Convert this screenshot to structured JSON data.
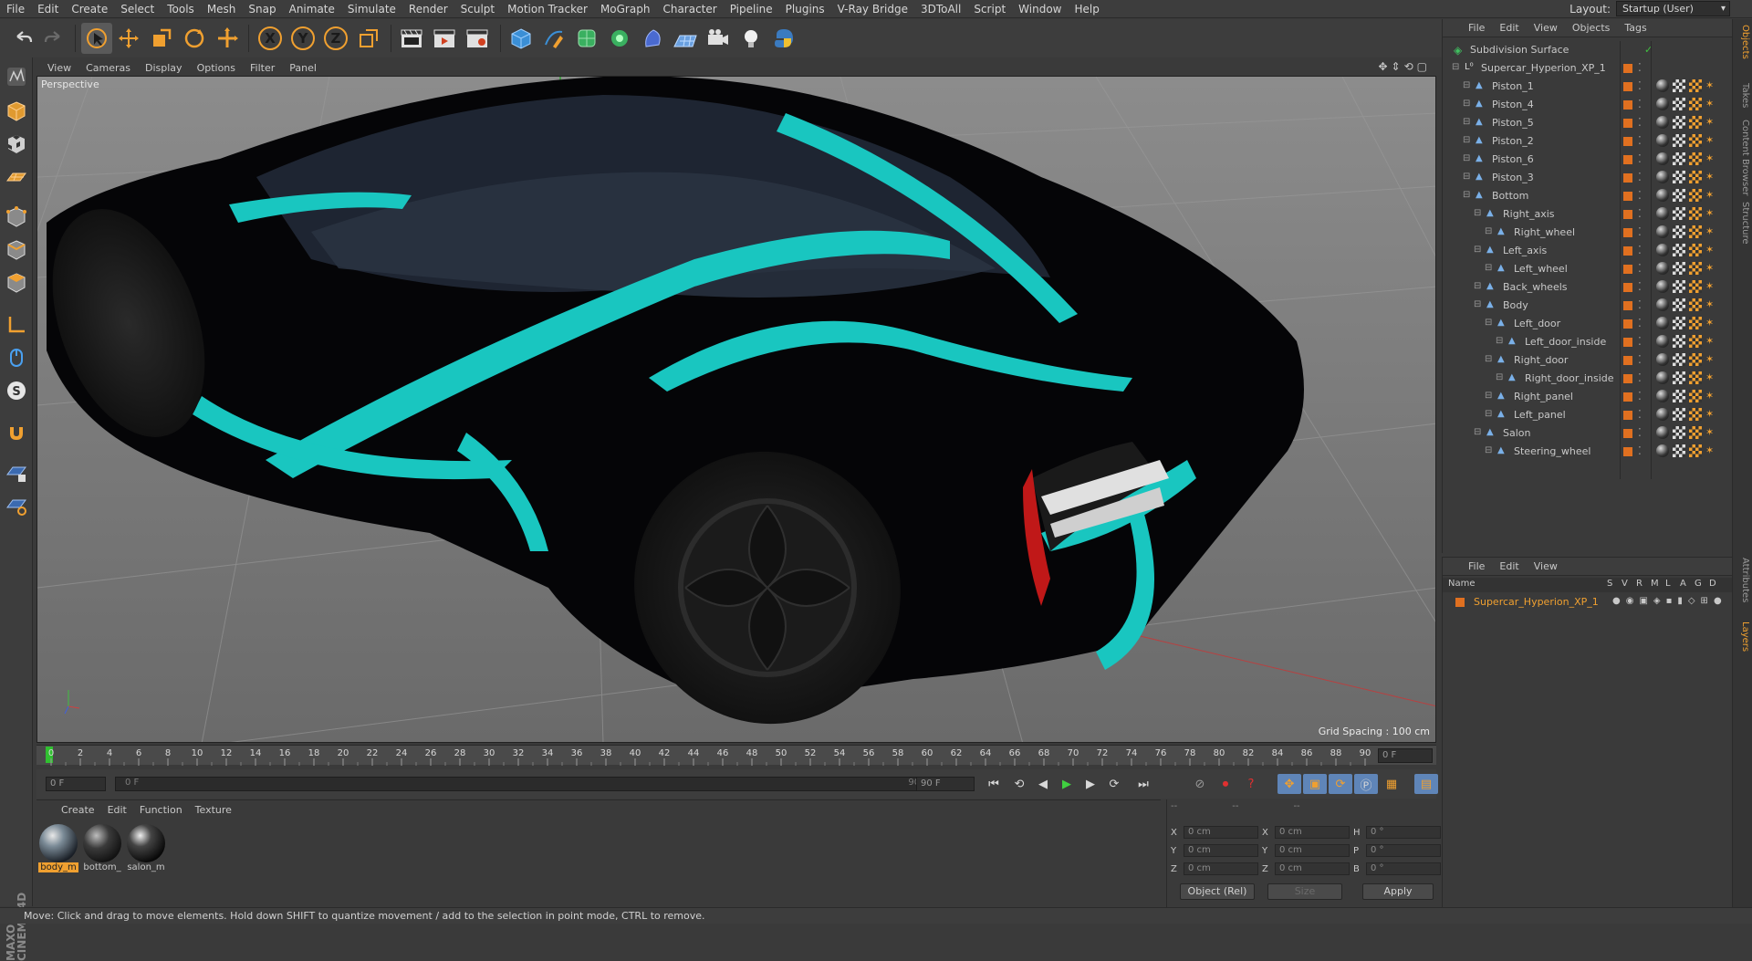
{
  "menubar": {
    "items": [
      "File",
      "Edit",
      "Create",
      "Select",
      "Tools",
      "Mesh",
      "Snap",
      "Animate",
      "Simulate",
      "Render",
      "Sculpt",
      "Motion Tracker",
      "MoGraph",
      "Character",
      "Pipeline",
      "Plugins",
      "V-Ray Bridge",
      "3DToAll",
      "Script",
      "Window",
      "Help"
    ],
    "layout_label": "Layout:",
    "layout_value": "Startup (User)"
  },
  "toolbar": {
    "axis_x": "X",
    "axis_y": "Y",
    "axis_z": "Z"
  },
  "viewport": {
    "menu": [
      "View",
      "Cameras",
      "Display",
      "Options",
      "Filter",
      "Panel"
    ],
    "label": "Perspective",
    "grid_spacing": "Grid Spacing : 100 cm"
  },
  "timeline": {
    "ticks": [
      "0",
      "2",
      "4",
      "6",
      "8",
      "10",
      "12",
      "14",
      "16",
      "18",
      "20",
      "22",
      "24",
      "26",
      "28",
      "30",
      "32",
      "34",
      "36",
      "38",
      "40",
      "42",
      "44",
      "46",
      "48",
      "50",
      "52",
      "54",
      "56",
      "58",
      "60",
      "62",
      "64",
      "66",
      "68",
      "70",
      "72",
      "74",
      "76",
      "78",
      "80",
      "82",
      "84",
      "86",
      "88",
      "90"
    ],
    "current_frame": "0 F",
    "start_field": "0 F",
    "range_start": "0 F",
    "range_end": "90 F",
    "end_field": "90 F"
  },
  "materials": {
    "menu": [
      "Create",
      "Edit",
      "Function",
      "Texture"
    ],
    "items": [
      {
        "name": "body_m",
        "selected": true
      },
      {
        "name": "bottom_",
        "selected": false
      },
      {
        "name": "salon_m",
        "selected": false
      }
    ]
  },
  "coords": {
    "header_left": "--",
    "header_mid": "--",
    "header_right": "--",
    "rows": [
      {
        "a": "X",
        "av": "0 cm",
        "b": "X",
        "bv": "0 cm",
        "c": "H",
        "cv": "0 °"
      },
      {
        "a": "Y",
        "av": "0 cm",
        "b": "Y",
        "bv": "0 cm",
        "c": "P",
        "cv": "0 °"
      },
      {
        "a": "Z",
        "av": "0 cm",
        "b": "Z",
        "bv": "0 cm",
        "c": "B",
        "cv": "0 °"
      }
    ],
    "mode_select": "Object (Rel)",
    "size_select": "Size",
    "apply": "Apply"
  },
  "object_manager": {
    "menu": [
      "File",
      "Edit",
      "View",
      "Objects",
      "Tags"
    ],
    "objects": [
      {
        "name": "Subdivision Surface",
        "depth": 0
      },
      {
        "name": "Supercar_Hyperion_XP_1",
        "depth": 1
      },
      {
        "name": "Piston_1",
        "depth": 2
      },
      {
        "name": "Piston_4",
        "depth": 2
      },
      {
        "name": "Piston_5",
        "depth": 2
      },
      {
        "name": "Piston_2",
        "depth": 2
      },
      {
        "name": "Piston_6",
        "depth": 2
      },
      {
        "name": "Piston_3",
        "depth": 2
      },
      {
        "name": "Bottom",
        "depth": 2
      },
      {
        "name": "Right_axis",
        "depth": 3
      },
      {
        "name": "Right_wheel",
        "depth": 4
      },
      {
        "name": "Left_axis",
        "depth": 3
      },
      {
        "name": "Left_wheel",
        "depth": 4
      },
      {
        "name": "Back_wheels",
        "depth": 3
      },
      {
        "name": "Body",
        "depth": 3
      },
      {
        "name": "Left_door",
        "depth": 4
      },
      {
        "name": "Left_door_inside",
        "depth": 5
      },
      {
        "name": "Right_door",
        "depth": 4
      },
      {
        "name": "Right_door_inside",
        "depth": 5
      },
      {
        "name": "Right_panel",
        "depth": 4
      },
      {
        "name": "Left_panel",
        "depth": 4
      },
      {
        "name": "Salon",
        "depth": 3
      },
      {
        "name": "Steering_wheel",
        "depth": 4
      }
    ]
  },
  "layer_manager": {
    "menu": [
      "File",
      "Edit",
      "View"
    ],
    "columns": [
      "Name",
      "S",
      "V",
      "R",
      "M",
      "L",
      "A",
      "G",
      "D"
    ],
    "layers": [
      {
        "name": "Supercar_Hyperion_XP_1"
      }
    ]
  },
  "side_tabs": [
    "Objects",
    "Takes",
    "Content Browser",
    "Structure",
    "Attributes",
    "Layers"
  ],
  "status": "Move: Click and drag to move elements. Hold down SHIFT to quantize movement / add to the selection in point mode, CTRL to remove.",
  "logo": "MAXON CINEMA 4D",
  "colors": {
    "accent": "#f0a030",
    "teal": "#19c6c0",
    "panel": "#3a3a3a"
  }
}
